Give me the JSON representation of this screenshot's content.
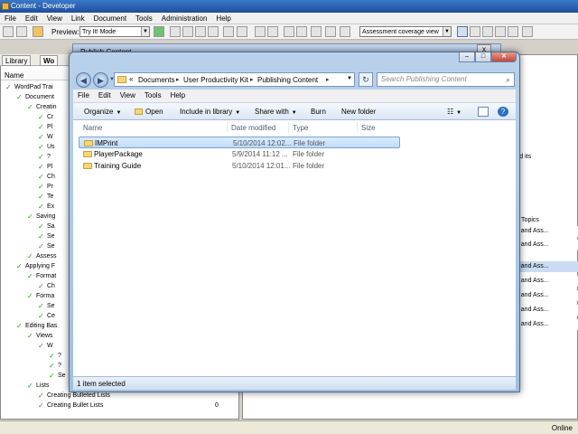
{
  "app": {
    "title": "Content - Developer",
    "menu": [
      "File",
      "Edit",
      "View",
      "Link",
      "Document",
      "Tools",
      "Administration",
      "Help"
    ],
    "preview_label": "Preview:",
    "preview_mode": "Try It! Mode",
    "view_mode": "Assessment coverage view",
    "tabs": [
      "Library",
      "Wo"
    ],
    "name_header": "Name",
    "tree": [
      {
        "label": "WordPad Trai"
      },
      {
        "label": "Document"
      },
      {
        "label": "Creatin"
      },
      {
        "label": "Cr"
      },
      {
        "label": "Pl"
      },
      {
        "label": "W"
      },
      {
        "label": "Us"
      },
      {
        "label": "?"
      },
      {
        "label": "Pl"
      },
      {
        "label": "Ch"
      },
      {
        "label": "Pr"
      },
      {
        "label": "Te"
      },
      {
        "label": "Ex"
      },
      {
        "label": "Saving"
      },
      {
        "label": "Sa"
      },
      {
        "label": "Se"
      },
      {
        "label": "Se"
      },
      {
        "label": "Assess"
      },
      {
        "label": "Applying F"
      },
      {
        "label": "Format"
      },
      {
        "label": "Ch"
      },
      {
        "label": "Forma"
      },
      {
        "label": "Se"
      },
      {
        "label": "Ce"
      },
      {
        "label": "Editing Bas"
      },
      {
        "label": "Views"
      },
      {
        "label": "W"
      },
      {
        "label": "?"
      },
      {
        "label": "?"
      },
      {
        "label": "Se"
      },
      {
        "label": "Lists"
      },
      {
        "label": "Creating Bulleted Lists"
      },
      {
        "label": "Creating Bullet Lists"
      }
    ],
    "tree_count": "0",
    "right_fragments": [
      "s and its",
      "onal Topics",
      "ions and Ass...",
      "ions and Ass...",
      "ions and Ass...",
      "ions and Ass...",
      "ions and Ass...",
      "ions and Ass...",
      "ions and Ass..."
    ],
    "status": "Online"
  },
  "publish_dialog": {
    "title": "Publish Content",
    "close": "x"
  },
  "explorer": {
    "breadcrumb_prefix": "«",
    "breadcrumb": [
      "Documents",
      "User Productivity Kit",
      "Publishing Content"
    ],
    "search_placeholder": "Search Publishing Content",
    "menu": [
      "File",
      "Edit",
      "View",
      "Tools",
      "Help"
    ],
    "commands": {
      "organize": "Organize",
      "open": "Open",
      "include": "Include in library",
      "share": "Share with",
      "burn": "Burn",
      "new_folder": "New folder"
    },
    "columns": [
      "Name",
      "Date modified",
      "Type",
      "Size"
    ],
    "files": [
      {
        "name": "IMPrint",
        "date": "5/10/2014 12:02...",
        "type": "File folder",
        "selected": true
      },
      {
        "name": "PlayerPackage",
        "date": "5/9/2014 11:12 ...",
        "type": "File folder",
        "selected": false
      },
      {
        "name": "Training Guide",
        "date": "5/10/2014 12:01...",
        "type": "File folder",
        "selected": false
      }
    ],
    "details": "1 item selected"
  }
}
